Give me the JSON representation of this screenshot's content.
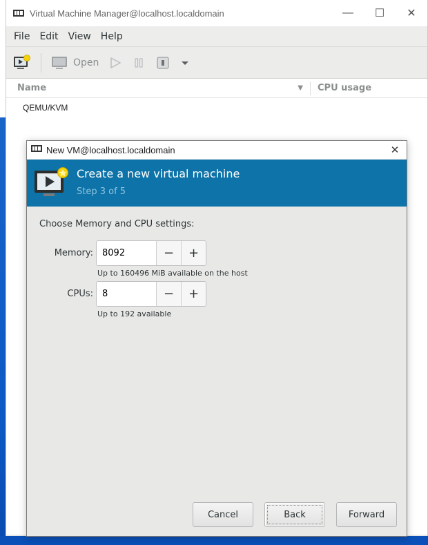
{
  "main_window": {
    "title": "Virtual Machine Manager@localhost.localdomain",
    "controls": {
      "minimize": "—",
      "maximize": "☐",
      "close": "✕"
    },
    "menu": [
      "File",
      "Edit",
      "View",
      "Help"
    ],
    "toolbar": {
      "open_label": "Open"
    },
    "columns": {
      "name": "Name",
      "cpu": "CPU usage"
    },
    "connections": [
      "QEMU/KVM"
    ]
  },
  "dialog": {
    "title": "New VM@localhost.localdomain",
    "close": "✕",
    "banner": {
      "title": "Create a new virtual machine",
      "step": "Step 3 of 5"
    },
    "section_label": "Choose Memory and CPU settings:",
    "memory": {
      "label": "Memory:",
      "value": "8092",
      "hint": "Up to 160496 MiB available on the host"
    },
    "cpus": {
      "label": "CPUs:",
      "value": "8",
      "hint": "Up to 192 available"
    },
    "spin": {
      "minus": "−",
      "plus": "+"
    },
    "buttons": {
      "cancel": "Cancel",
      "back": "Back",
      "forward": "Forward"
    }
  },
  "colors": {
    "banner": "#0e73a8",
    "banner_subtitle": "#8ec3e0",
    "desktop": "#0d59c4"
  }
}
